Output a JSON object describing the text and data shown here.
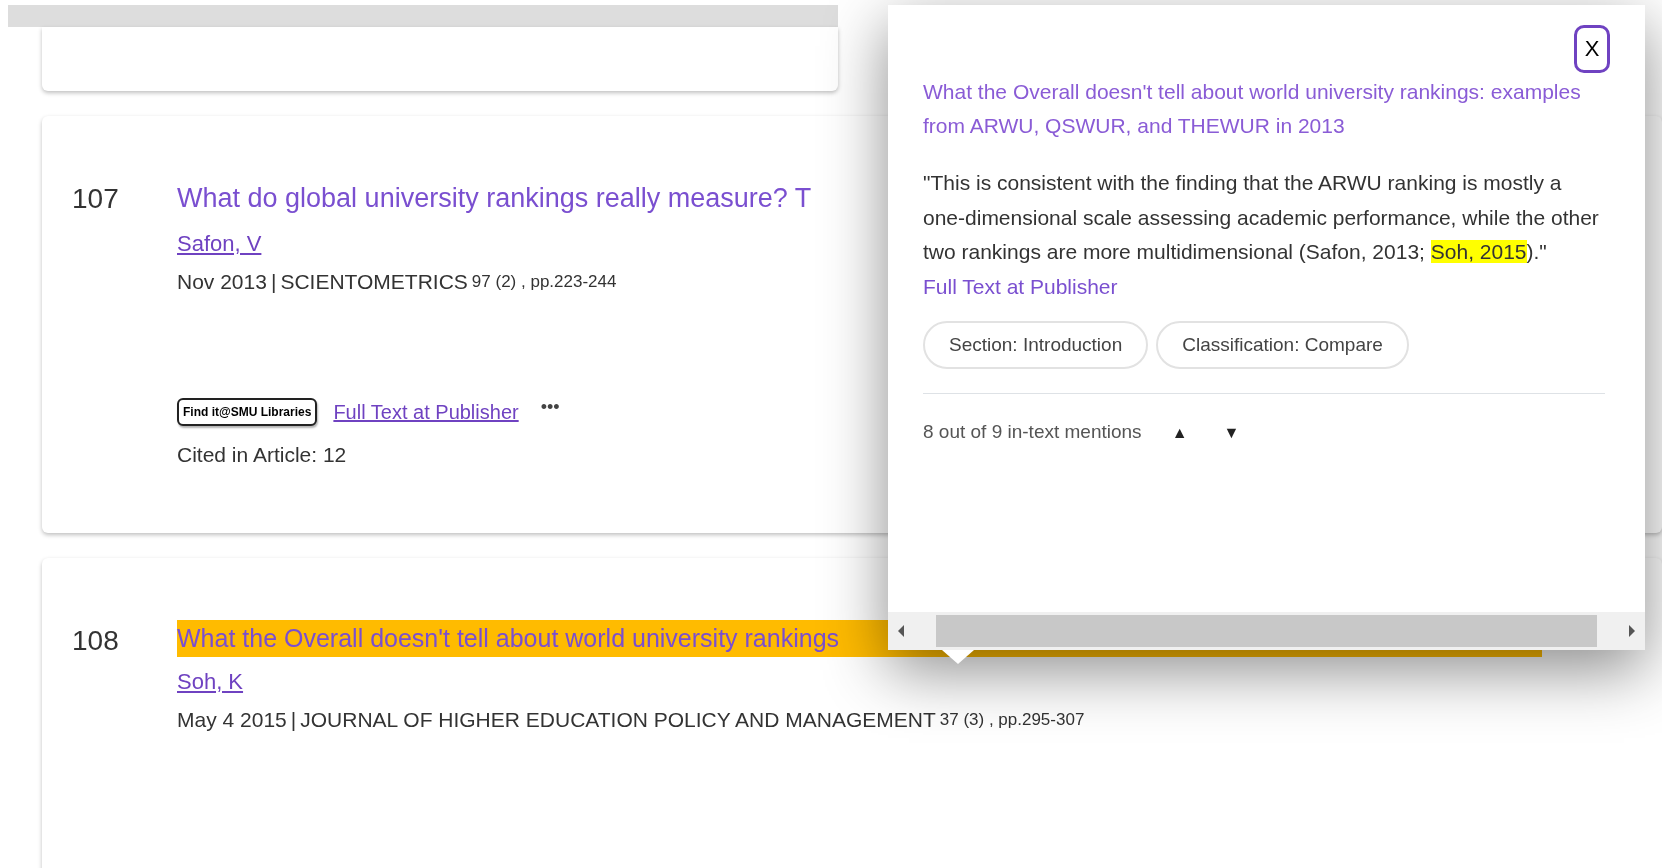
{
  "results": [
    {
      "number": "107",
      "title": "What do global university rankings really measure? T",
      "highlighted": false,
      "authors": "Safon, V",
      "date": "Nov 2013",
      "separator": "|",
      "journal": "SCIENTOMETRICS",
      "volume": "97 (2) , pp.223-244",
      "findit": "Find it@SMU Libraries",
      "full_text_link": "Full Text at Publisher",
      "more": "•••",
      "cited": "Cited in Article: 12"
    },
    {
      "number": "108",
      "title": "What the Overall doesn't tell about world university rankings",
      "highlighted": true,
      "authors": "Soh, K",
      "date": "May 4 2015",
      "separator": "|",
      "journal": "JOURNAL OF HIGHER EDUCATION POLICY AND MANAGEMENT",
      "volume": "37 (3) , pp.295-307"
    }
  ],
  "popover": {
    "close": "X",
    "title": "What the Overall doesn't tell about world university rankings: examples from ARWU, QSWUR, and THEWUR in 2013",
    "quote": [
      {
        "text": "\"This is consistent with the finding that the ARWU ranking is mostly a one-dimensional scale assessing academic performance, while the other two rankings are more multidimensional (Safon, 2013; ",
        "highlighted": false
      },
      {
        "text": "Soh, 2015",
        "highlighted": true
      },
      {
        "text": ").\"",
        "highlighted": false
      }
    ],
    "link": "Full Text at Publisher",
    "tags": [
      "Section: Introduction",
      "Classification: Compare"
    ],
    "mentions": "8 out of 9 in-text mentions",
    "prev": "▲",
    "next": "▼"
  }
}
